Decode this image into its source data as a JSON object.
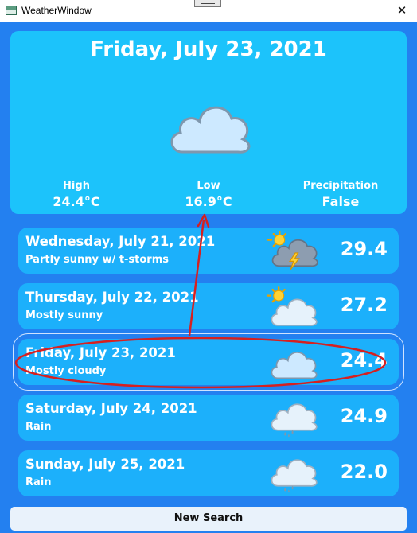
{
  "window": {
    "title": "WeatherWindow",
    "close_glyph": "✕"
  },
  "current": {
    "date": "Friday, July 23, 2021",
    "icon": "cloud-icon",
    "high_label": "High",
    "high_value": "24.4°C",
    "low_label": "Low",
    "low_value": "16.9°C",
    "precip_label": "Precipitation",
    "precip_value": "False"
  },
  "forecast": [
    {
      "date": "Wednesday, July 21, 2021",
      "desc": "Partly sunny w/ t-storms",
      "temp": "29.4",
      "icon": "partly-sunny-thunderstorm-icon"
    },
    {
      "date": "Thursday, July 22, 2021",
      "desc": "Mostly sunny",
      "temp": "27.2",
      "icon": "mostly-sunny-icon"
    },
    {
      "date": "Friday, July 23, 2021",
      "desc": "Mostly cloudy",
      "temp": "24.4",
      "icon": "cloud-icon"
    },
    {
      "date": "Saturday, July 24, 2021",
      "desc": "Rain",
      "temp": "24.9",
      "icon": "rain-cloud-icon"
    },
    {
      "date": "Sunday, July 25, 2021",
      "desc": "Rain",
      "temp": "22.0",
      "icon": "rain-cloud-icon"
    }
  ],
  "actions": {
    "new_search_label": "New Search"
  },
  "colors": {
    "background": "#2380f0",
    "hero": "#1cc3fb",
    "card": "#1cb0fb",
    "annotation": "#d62020"
  }
}
